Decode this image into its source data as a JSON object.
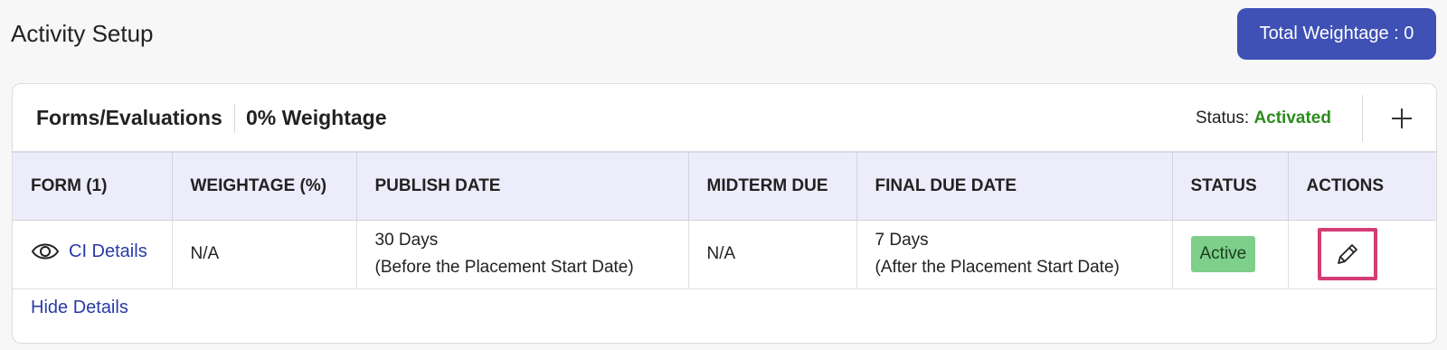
{
  "header": {
    "title": "Activity Setup",
    "total_weightage_label": "Total Weightage : 0"
  },
  "card": {
    "title": "Forms/Evaluations",
    "weightage": "0% Weightage",
    "status_label": "Status:",
    "status_value": "Activated"
  },
  "table": {
    "columns": [
      "FORM (1)",
      "WEIGHTAGE (%)",
      "PUBLISH DATE",
      "MIDTERM DUE",
      "FINAL DUE DATE",
      "STATUS",
      "ACTIONS"
    ],
    "rows": [
      {
        "form_name": "CI Details",
        "weightage": "N/A",
        "publish_line1": "30 Days",
        "publish_line2": "(Before the Placement Start Date)",
        "midterm": "N/A",
        "final_line1": "7 Days",
        "final_line2": "(After the Placement Start Date)",
        "status": "Active"
      }
    ]
  },
  "footer": {
    "hide_details": "Hide Details"
  },
  "colors": {
    "primary": "#3f51b5",
    "activated": "#2e8b1e",
    "status_active_bg": "#7dcf8a",
    "link": "#2a3aa8",
    "highlight": "#d33d75"
  },
  "icons": [
    "eye-icon",
    "pencil-icon",
    "plus-icon"
  ]
}
